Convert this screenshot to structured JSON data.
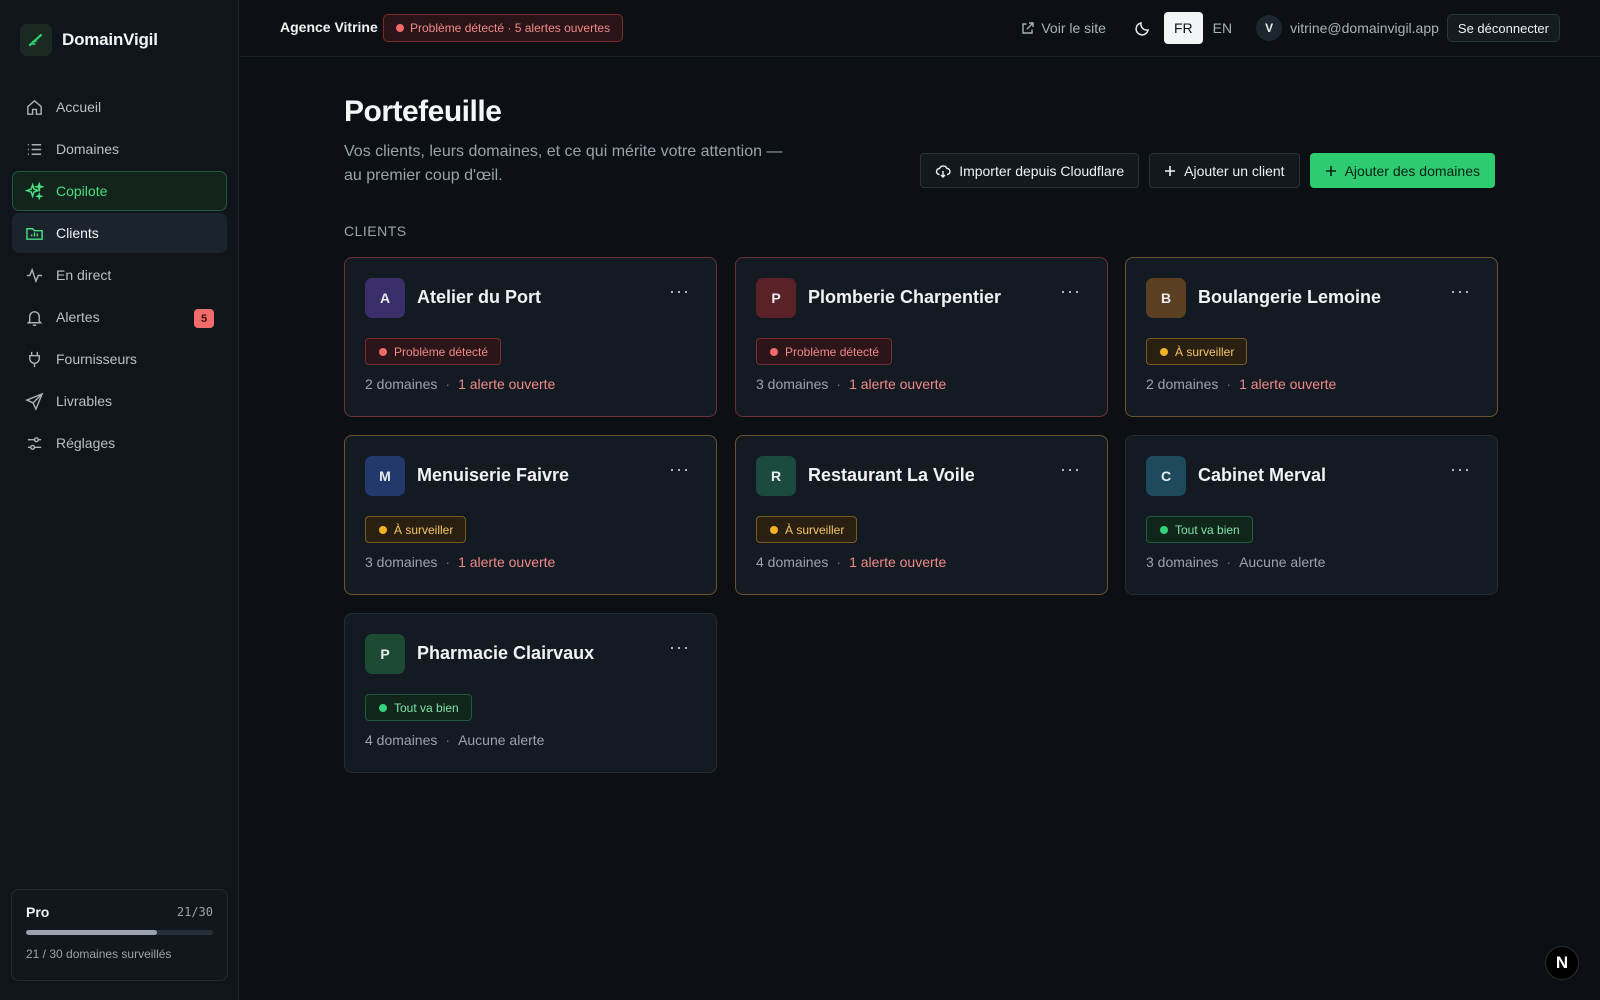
{
  "app": {
    "name": "DomainVigil"
  },
  "sidebar": {
    "items": [
      {
        "label": "Accueil",
        "icon": "home-icon"
      },
      {
        "label": "Domaines",
        "icon": "list-icon"
      },
      {
        "label": "Copilote",
        "icon": "sparkles-icon"
      },
      {
        "label": "Clients",
        "icon": "folder-chart-icon"
      },
      {
        "label": "En direct",
        "icon": "activity-icon"
      },
      {
        "label": "Alertes",
        "icon": "bell-icon",
        "badge": "5"
      },
      {
        "label": "Fournisseurs",
        "icon": "plug-icon"
      },
      {
        "label": "Livrables",
        "icon": "send-icon"
      },
      {
        "label": "Réglages",
        "icon": "sliders-icon"
      }
    ],
    "plan": {
      "name": "Pro",
      "count": "21/30",
      "progress": 0.7,
      "caption": "21 / 30 domaines surveillés"
    }
  },
  "topbar": {
    "agency": "Agence Vitrine",
    "alert": "Problème détecté · 5 alertes ouvertes",
    "view_site": "Voir le site",
    "lang_fr": "FR",
    "lang_en": "EN",
    "user_initial": "V",
    "user_email": "vitrine@domainvigil.app",
    "logout": "Se déconnecter"
  },
  "page": {
    "title": "Portefeuille",
    "subtitle": "Vos clients, leurs domaines, et ce qui mérite votre attention — au premier coup d'œil.",
    "actions": {
      "import": "Importer depuis Cloudflare",
      "add_client": "Ajouter un client",
      "add_domains": "Ajouter des domaines"
    },
    "section_label": "CLIENTS"
  },
  "clients": [
    {
      "initial": "A",
      "name": "Atelier du Port",
      "status": "Problème détecté",
      "domains": "2 domaines",
      "alerts": "1 alerte ouverte"
    },
    {
      "initial": "P",
      "name": "Plomberie Charpentier",
      "status": "Problème détecté",
      "domains": "3 domaines",
      "alerts": "1 alerte ouverte"
    },
    {
      "initial": "B",
      "name": "Boulangerie Lemoine",
      "status": "À surveiller",
      "domains": "2 domaines",
      "alerts": "1 alerte ouverte"
    },
    {
      "initial": "M",
      "name": "Menuiserie Faivre",
      "status": "À surveiller",
      "domains": "3 domaines",
      "alerts": "1 alerte ouverte"
    },
    {
      "initial": "R",
      "name": "Restaurant La Voile",
      "status": "À surveiller",
      "domains": "4 domaines",
      "alerts": "1 alerte ouverte"
    },
    {
      "initial": "C",
      "name": "Cabinet Merval",
      "status": "Tout va bien",
      "domains": "3 domaines",
      "alerts": "Aucune alerte"
    },
    {
      "initial": "P",
      "name": "Pharmacie Clairvaux",
      "status": "Tout va bien",
      "domains": "4 domaines",
      "alerts": "Aucune alerte"
    }
  ],
  "meta_separator": "·",
  "card_menu": "···",
  "colors": {
    "accent": "#2ecc71",
    "danger": "#f26b6b",
    "warning": "#f5b324",
    "success": "#34d27a"
  },
  "dev_badge": "N"
}
